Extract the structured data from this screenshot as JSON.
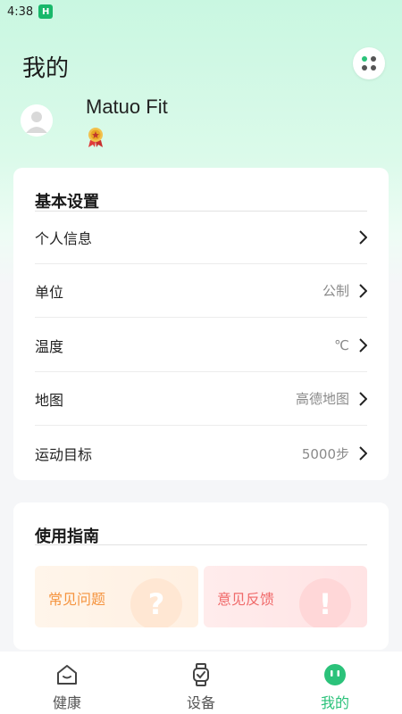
{
  "status_bar": {
    "time": "4:38",
    "app_icon_letter": "H"
  },
  "header": {
    "title": "我的",
    "menu_icon": "dots-menu-icon"
  },
  "profile": {
    "name": "Matuo Fit",
    "badge_icon": "medal-icon"
  },
  "settings": {
    "title": "基本设置",
    "rows": [
      {
        "label": "个人信息",
        "value": ""
      },
      {
        "label": "单位",
        "value": "公制"
      },
      {
        "label": "温度",
        "value": "℃"
      },
      {
        "label": "地图",
        "value": "高德地图"
      },
      {
        "label": "运动目标",
        "value": "5000步"
      }
    ]
  },
  "guide": {
    "title": "使用指南",
    "tiles": [
      {
        "label": "常见问题",
        "icon": "question-icon",
        "glyph": "?"
      },
      {
        "label": "意见反馈",
        "icon": "exclamation-icon",
        "glyph": "!"
      }
    ]
  },
  "nav": {
    "items": [
      {
        "label": "健康",
        "icon": "home-icon"
      },
      {
        "label": "设备",
        "icon": "watch-icon"
      },
      {
        "label": "我的",
        "icon": "smiley-icon",
        "active": true
      }
    ]
  },
  "colors": {
    "accent": "#2bc27a",
    "faq_text": "#f5943f",
    "feedback_text": "#f06a6a"
  }
}
